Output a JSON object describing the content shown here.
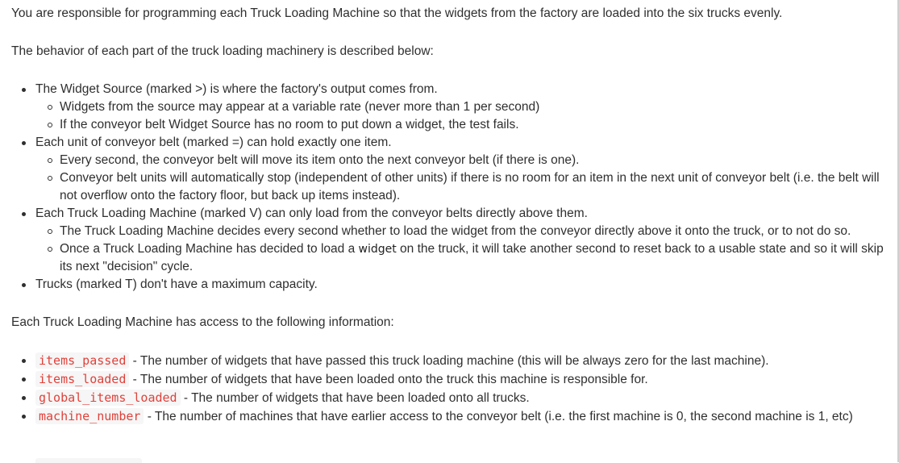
{
  "intro": "You are responsible for programming each Truck Loading Machine so that the widgets from the factory are loaded into the six trucks evenly.",
  "behavior_heading": "The behavior of each part of the truck loading machinery is described below:",
  "parts": {
    "source": "The Widget Source (marked >) is where the factory's output comes from.",
    "source_sub_1": "Widgets from the source may appear at a variable rate (never more than 1 per second)",
    "source_sub_2": "If the conveyor belt Widget Source has no room to put down a widget, the test fails.",
    "belt": "Each unit of conveyor belt (marked =) can hold exactly one item.",
    "belt_sub_1": "Every second, the conveyor belt will move its item onto the next conveyor belt (if there is one).",
    "belt_sub_2": "Conveyor belt units will automatically stop (independent of other units) if there is no room for an item in the next unit of conveyor belt (i.e. the belt will not overflow onto the factory floor, but back up items instead).",
    "machine": "Each Truck Loading Machine (marked V) can only load from the conveyor belts directly above them.",
    "machine_sub_1": "The Truck Loading Machine decides every second whether to load the widget from the conveyor directly above it onto the truck, or to not do so.",
    "machine_sub_2_before": "Once a Truck Loading Machine has decided to load a ",
    "machine_sub_2_word": "widget",
    "machine_sub_2_after": " on the truck, it will take another second to reset back to a usable state and so it will skip its next \"decision\" cycle.",
    "trucks": "Trucks (marked T) don't have a maximum capacity."
  },
  "access_heading": "Each Truck Loading Machine has access to the following information:",
  "info": {
    "items_passed_code": "items_passed",
    "items_passed_desc": " - The number of widgets that have passed this truck loading machine (this will be always zero for the last machine).",
    "items_loaded_code": "items_loaded",
    "items_loaded_desc": " - The number of widgets that have been loaded onto the truck this machine is responsible for.",
    "global_code": "global_items_loaded",
    "global_desc": " - The number of widgets that have been loaded onto all trucks.",
    "machine_number_code": "machine_number",
    "machine_number_desc": " - The number of machines that have earlier access to the conveyor belt (i.e. the first machine is 0, the second machine is 1, etc)"
  }
}
